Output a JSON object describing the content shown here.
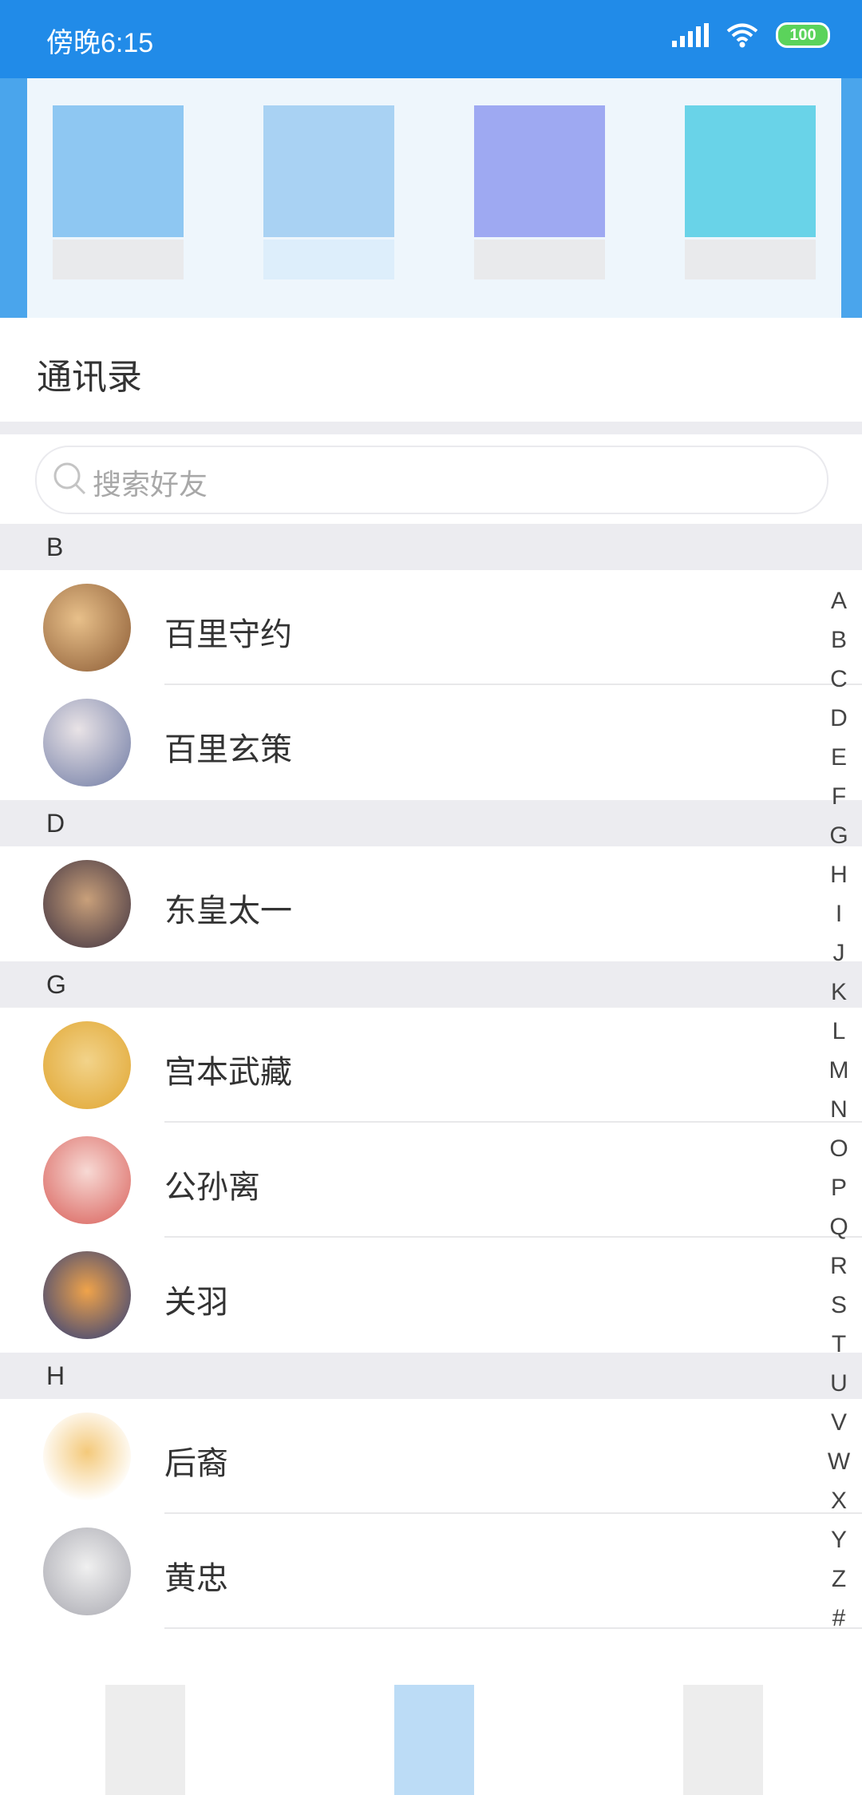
{
  "status_bar": {
    "time": "傍晚6:15",
    "battery": "100"
  },
  "page_title": "通讯录",
  "search": {
    "placeholder": "搜索好友"
  },
  "groups": [
    {
      "letter": "B",
      "contacts": [
        "百里守约",
        "百里玄策"
      ]
    },
    {
      "letter": "D",
      "contacts": [
        "东皇太一"
      ]
    },
    {
      "letter": "G",
      "contacts": [
        "宫本武藏",
        "公孙离",
        "关羽"
      ]
    },
    {
      "letter": "H",
      "contacts": [
        "后裔",
        "黄忠"
      ]
    }
  ],
  "index_letters": [
    "A",
    "B",
    "C",
    "D",
    "E",
    "F",
    "G",
    "H",
    "I",
    "J",
    "K",
    "L",
    "M",
    "N",
    "O",
    "P",
    "Q",
    "R",
    "S",
    "T",
    "U",
    "V",
    "W",
    "X",
    "Y",
    "Z",
    "#"
  ],
  "colors": {
    "status_bar": "#218be8",
    "header": "#4aa5ec",
    "group_header_bg": "#ececf0",
    "battery_fill": "#5bd35b"
  }
}
